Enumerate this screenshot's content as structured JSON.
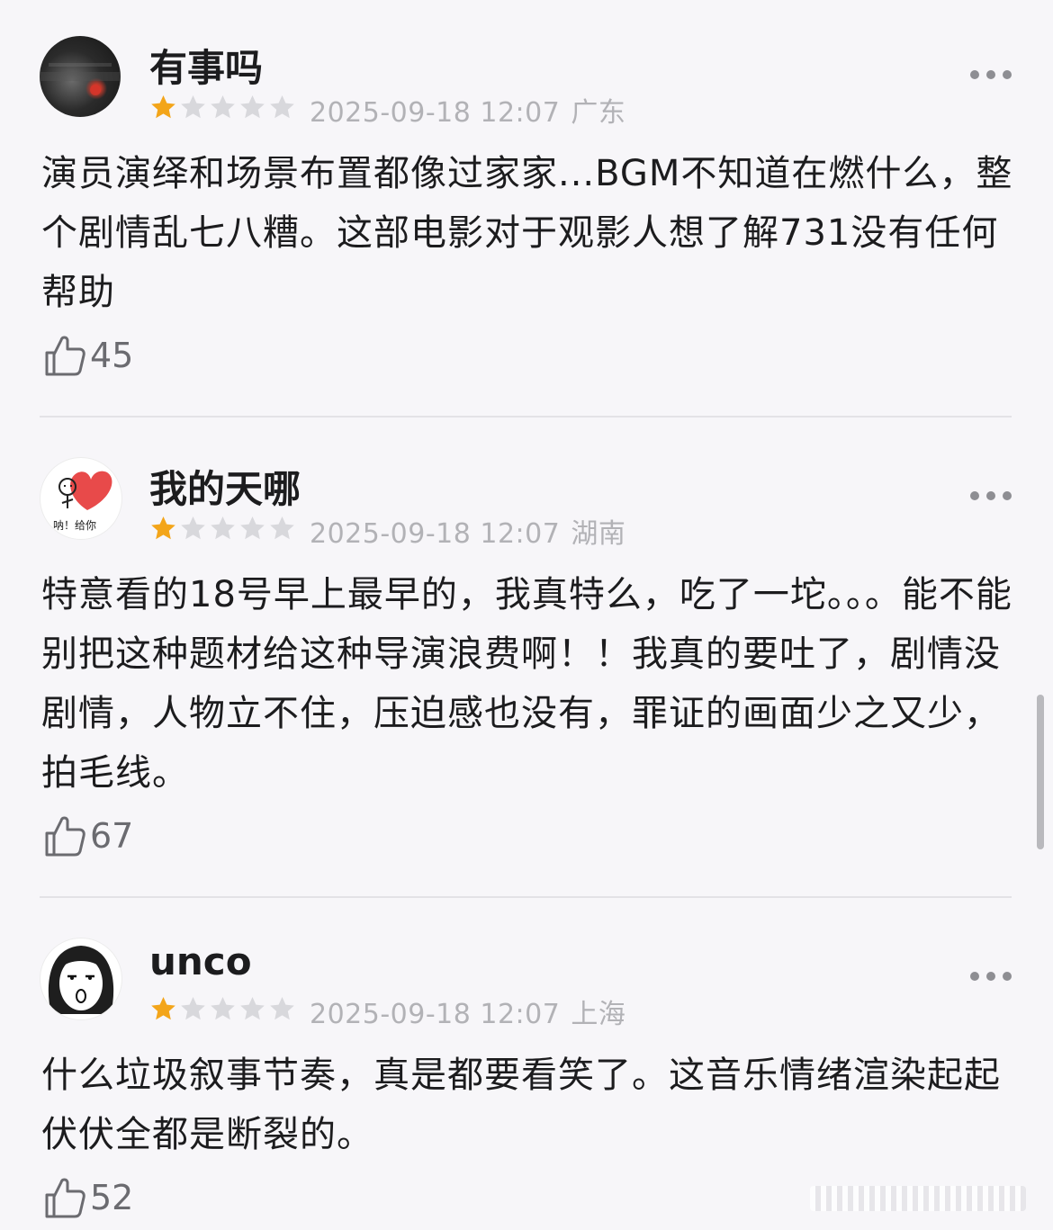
{
  "reviews": [
    {
      "username": "有事吗",
      "rating": 1,
      "max_rating": 5,
      "date": "2025-09-18 12:07",
      "location": "广东",
      "text": "演员演绎和场景布置都像过家家...BGM不知道在燃什么，整个剧情乱七八糟。这部电影对于观影人想了解731没有任何帮助",
      "likes": "45",
      "avatar": "dark-photo-avatar"
    },
    {
      "username": "我的天哪",
      "rating": 1,
      "max_rating": 5,
      "date": "2025-09-18 12:07",
      "location": "湖南",
      "text": "特意看的18号早上最早的，我真特么，吃了一坨。。。能不能别把这种题材给这种导演浪费啊！！我真的要吐了，剧情没剧情，人物立不住，压迫感也没有，罪证的画面少之又少，拍毛线。",
      "likes": "67",
      "avatar": "heart-sticker-avatar",
      "avatar_caption": "呐！给你"
    },
    {
      "username": "unco",
      "rating": 1,
      "max_rating": 5,
      "date": "2025-09-18 12:07",
      "location": "上海",
      "text": "什么垃圾叙事节奏，真是都要看笑了。这音乐情绪渲染起起伏伏全都是断裂的。",
      "likes": "52",
      "avatar": "sketch-face-avatar"
    }
  ],
  "colors": {
    "star_filled": "#f3a51a",
    "star_empty": "#d8d8dc",
    "meta_text": "#b2b2b6",
    "background": "#f7f6f9"
  }
}
